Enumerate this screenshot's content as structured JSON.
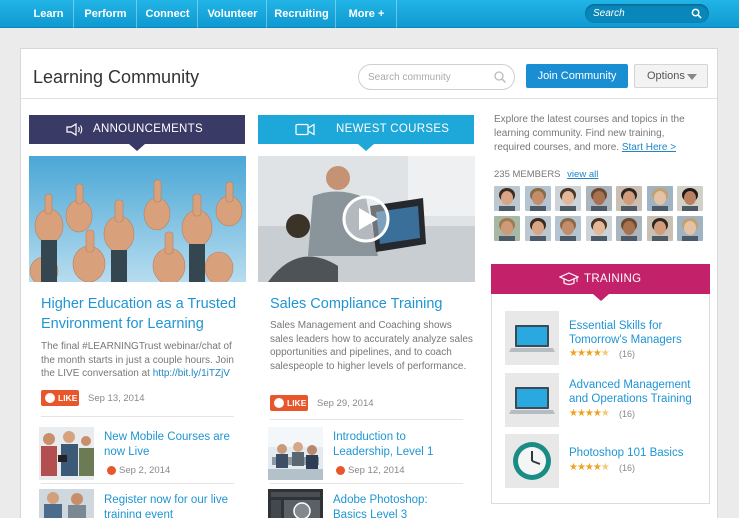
{
  "nav": {
    "items": [
      "Learn",
      "Perform",
      "Connect",
      "Volunteer",
      "Recruiting",
      "More +"
    ],
    "search_placeholder": "Search"
  },
  "header": {
    "title": "Learning Community",
    "search_placeholder": "Search community",
    "join_label": "Join Community",
    "options_label": "Options"
  },
  "announcements": {
    "heading": "ANNOUNCEMENTS",
    "featured": {
      "title": "Higher Education as a Trusted Environment for Learning",
      "body": "The final #LEARNINGTrust webinar/chat of the month starts in just a couple hours. Join the LIVE conversation at ",
      "link": "http://bit.ly/1iTZjV",
      "like": "LIKE",
      "date": "Sep 13, 2014"
    },
    "items": [
      {
        "title": "New Mobile Courses are now Live",
        "date": "Sep 2, 2014"
      },
      {
        "title": "Register now for our live training event",
        "date": ""
      }
    ]
  },
  "courses": {
    "heading": "NEWEST COURSES",
    "featured": {
      "title": "Sales Compliance Training",
      "body": "Sales Management and Coaching shows sales leaders how to accurately analyze sales opportunities and pipelines, and to coach salespeople to higher levels of performance.",
      "like": "LIKE",
      "date": "Sep 29, 2014"
    },
    "items": [
      {
        "title": "Introduction to Leadership, Level 1",
        "date": "Sep 12, 2014"
      },
      {
        "title": "Adobe Photoshop: Basics Level 3",
        "date": ""
      }
    ]
  },
  "sidebar": {
    "intro": "Explore the latest courses and topics in the learning community. Find new training, required courses, and more.",
    "intro_link": "Start Here >",
    "members_count": "235 MEMBERS",
    "view_all": "view all",
    "training_heading": "TRAINING",
    "training": [
      {
        "title": "Essential Skills for Tomorrow's Managers",
        "rating": 4.5,
        "count": "(16)"
      },
      {
        "title": "Advanced Management and Operations Training",
        "rating": 4.5,
        "count": "(16)"
      },
      {
        "title": "Photoshop 101 Basics",
        "rating": 4.5,
        "count": "(16)"
      }
    ]
  },
  "colors": {
    "nav": "#15a7de",
    "announcements": "#3a3a66",
    "courses": "#1ea7d9",
    "training": "#c3226b",
    "link": "#1f95d3",
    "like": "#e8572b"
  }
}
